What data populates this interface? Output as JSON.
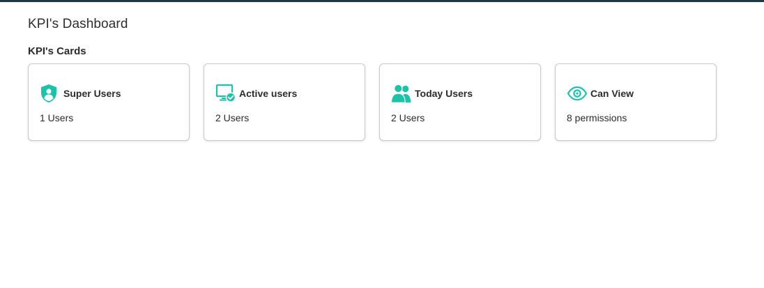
{
  "page": {
    "title": "KPI's Dashboard",
    "section_title": "KPI's Cards"
  },
  "theme": {
    "accent": "#1bc3a9",
    "top_bar": "#1d3a43"
  },
  "cards": [
    {
      "icon": "shield-user-icon",
      "title": "Super Users",
      "value": "1 Users"
    },
    {
      "icon": "monitor-check-icon",
      "title": "Active users",
      "value": "2 Users"
    },
    {
      "icon": "users-icon",
      "title": "Today Users",
      "value": "2 Users"
    },
    {
      "icon": "eye-icon",
      "title": "Can View",
      "value": "8 permissions"
    }
  ]
}
